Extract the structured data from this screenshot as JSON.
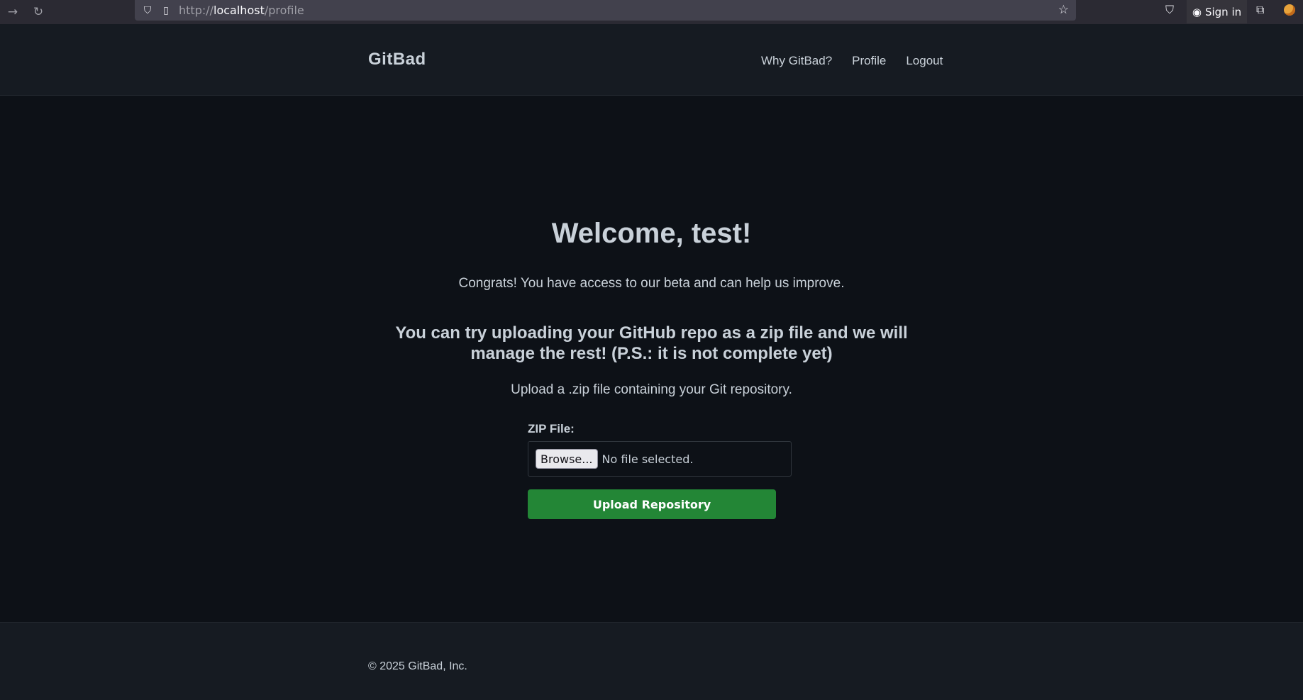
{
  "browser": {
    "url_scheme": "http://",
    "url_host": "localhost",
    "url_path": "/profile",
    "sign_in_label": "Sign in",
    "icons": [
      "forward-icon",
      "reload-icon",
      "shield-icon",
      "page-icon",
      "bookmark-star-icon",
      "pocket-icon",
      "account-icon",
      "extensions-icon",
      "profile-avatar-icon"
    ]
  },
  "header": {
    "brand": "GitBad",
    "nav": {
      "why": "Why GitBad?",
      "profile": "Profile",
      "logout": "Logout"
    }
  },
  "main": {
    "welcome": "Welcome, test!",
    "congrats": "Congrats! You have access to our beta and can help us improve.",
    "subheading": "You can try uploading your GitHub repo as a zip file and we will manage the rest! (P.S.: it is not complete yet)",
    "instructions": "Upload a .zip file containing your Git repository.",
    "form": {
      "label": "ZIP File:",
      "browse_label": "Browse...",
      "file_status": "No file selected.",
      "submit_label": "Upload Repository"
    }
  },
  "footer": {
    "copyright": "© 2025 GitBad, Inc."
  },
  "colors": {
    "page_bg": "#0d1117",
    "header_bg": "#161b22",
    "text": "#c9d1d9",
    "button_green": "#238636"
  }
}
